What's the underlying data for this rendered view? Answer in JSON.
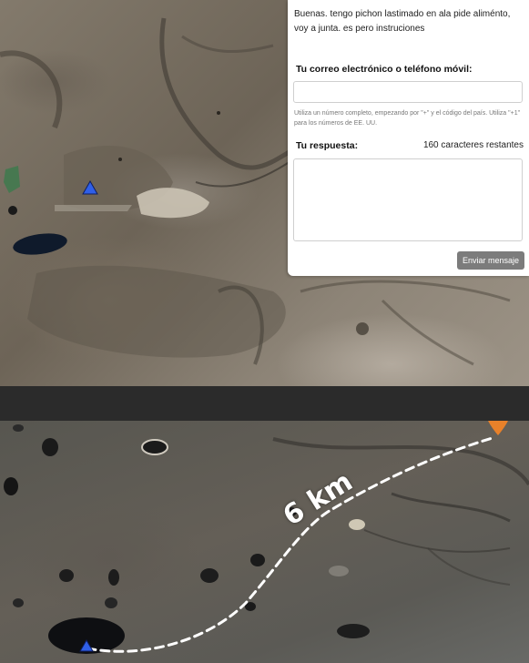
{
  "contact_form": {
    "message": "Buenas. tengo pichon lastimado en ala pide aliménto, voy a junta. es pero instruciones",
    "email_label": "Tu correo electrónico o teléfono móvil:",
    "email_value": "",
    "email_hint": "Utiliza un número completo, empezando por \"+\" y el código del país. Utiliza \"+1\" para los números de EE. UU.",
    "answer_label": "Tu respuesta:",
    "char_counter": "160 caracteres restantes",
    "answer_value": "",
    "send_button": "Enviar mensaje"
  },
  "map_bottom": {
    "distance_label": "6 km"
  },
  "colors": {
    "marker_blue": "#2f5fe8",
    "pin_orange": "#e8812a",
    "route_dashed": "#ffffff",
    "button_gray": "#7c7c7c"
  },
  "icons": [
    "location-triangle-icon",
    "map-pin-icon"
  ]
}
